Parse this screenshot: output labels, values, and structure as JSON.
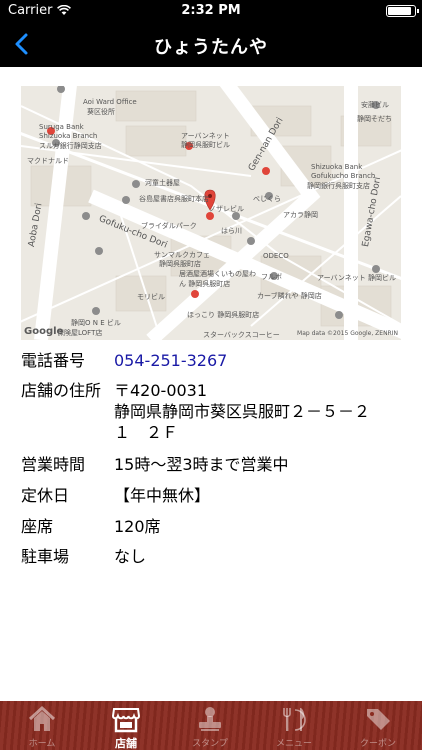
{
  "status_bar": {
    "carrier": "Carrier",
    "time": "2:32 PM"
  },
  "nav": {
    "title": "ひょうたんや"
  },
  "map": {
    "labels": {
      "aoi_ward_office": "Aoi Ward Office",
      "aoi_ward_office_ja": "葵区役所",
      "suruga_bank": "Suruga Bank",
      "suruga_bank_branch": "Shizuoka Branch",
      "suruga_bank_ja": "スルガ銀行静岡支店",
      "mcdonalds": "マクドナルド",
      "kawamura": "河童土器屋",
      "takashimaya": "谷島屋書店呉服町本店",
      "bridal": "ブライダルパーク",
      "sanmarku": "サンマルクカフェ",
      "sanmarku2": "静岡呉服町店",
      "morishita": "モリビル",
      "hoshino": "ほっこり 静岡呉服町店",
      "loft": "静岡O N E ビル",
      "loft2": "保険屋LOFT店",
      "starbucks": "スターバックスコーヒー",
      "apanet": "アーバンネット",
      "apanet2": "静岡呉服町ビル",
      "shizuoka_bank": "Shizuoka Bank",
      "shizuoka_bank2": "Gofukucho Branch",
      "shizuoka_bank3": "静岡銀行呉服町支店",
      "bekkura": "べじくら",
      "akara": "アカラ静岡",
      "sushiya": "安藤ビル",
      "sodati": "静岡そだち",
      "odeco": "ODECO",
      "harakawa": "はら川",
      "furubo": "フルボ",
      "ruby": "カーブ隣れや 静岡店",
      "apanet3": "アーバンネット 静岡ビル",
      "kuyuno": "居酒屋酒場くいもの屋わん 静岡呉服町店",
      "noshiro": "ノザレビル"
    },
    "roads": {
      "aoba": "Aoba Dori",
      "gofukucho": "Gofuku-cho Dori",
      "gennan": "Gen-nan Dori",
      "egawacho": "Egawa-cho Dori"
    },
    "attribution": "Map data ©2015 Google, ZENRIN",
    "google": "Google"
  },
  "info": {
    "phone_label": "電話番号",
    "phone_value": "054-251-3267",
    "address_label": "店舗の住所",
    "address_line1": "〒420-0031",
    "address_line2": "静岡県静岡市葵区呉服町２－５－２",
    "address_line3": "１　２Ｆ",
    "hours_label": "営業時間",
    "hours_value": "15時～翌3時まで営業中",
    "holiday_label": "定休日",
    "holiday_value": "【年中無休】",
    "seats_label": "座席",
    "seats_value": "120席",
    "parking_label": "駐車場",
    "parking_value": "なし"
  },
  "tabs": [
    {
      "label": "ホーム",
      "icon": "home-icon",
      "active": false
    },
    {
      "label": "店舗",
      "icon": "store-icon",
      "active": true
    },
    {
      "label": "スタンプ",
      "icon": "stamp-icon",
      "active": false
    },
    {
      "label": "メニュー",
      "icon": "menu-icon",
      "active": false
    },
    {
      "label": "クーポン",
      "icon": "coupon-icon",
      "active": false
    }
  ],
  "colors": {
    "nav_bg": "#000000",
    "tab_bg": "#8a2b20",
    "link": "#1a1aa6"
  }
}
